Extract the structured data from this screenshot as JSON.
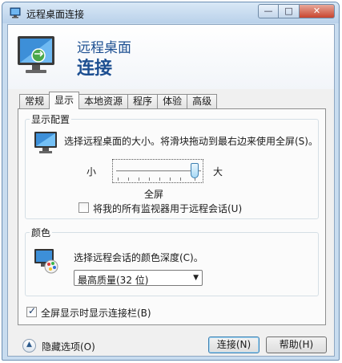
{
  "window": {
    "title": "远程桌面连接",
    "min_label": "—",
    "max_label": "□",
    "close_label": "✕"
  },
  "banner": {
    "line1": "远程桌面",
    "line2": "连接"
  },
  "tabs": [
    {
      "label": "常规",
      "active": false
    },
    {
      "label": "显示",
      "active": true
    },
    {
      "label": "本地资源",
      "active": false
    },
    {
      "label": "程序",
      "active": false
    },
    {
      "label": "体验",
      "active": false
    },
    {
      "label": "高级",
      "active": false
    }
  ],
  "display_config": {
    "group_title": "显示配置",
    "description": "选择远程桌面的大小。将滑块拖动到最右边来使用全屏(S)。",
    "slider_min_label": "小",
    "slider_max_label": "大",
    "slider_value_label": "全屏",
    "slider_level": 1.0,
    "all_monitors_label": "将我的所有监视器用于远程会话(U)",
    "all_monitors_checked": false
  },
  "color": {
    "group_title": "颜色",
    "description": "选择远程会话的颜色深度(C)。",
    "selected": "最高质量(32 位)"
  },
  "connection_bar": {
    "label": "全屏显示时显示连接栏(B)",
    "checked": true
  },
  "footer": {
    "hide_options_label": "隐藏选项(O)",
    "connect_label": "连接(N)",
    "help_label": "帮助(H)"
  },
  "colors": {
    "title_blue": "#1d4f91",
    "accent": "#3c7fb1"
  }
}
